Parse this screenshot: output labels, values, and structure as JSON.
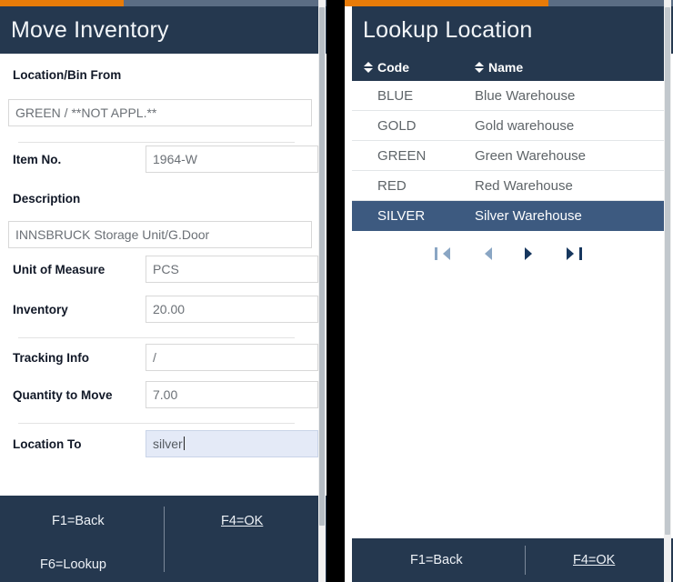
{
  "left_panel": {
    "title": "Move Inventory",
    "progress_color": "#e87b08",
    "fields": [
      {
        "label": "Location/Bin From",
        "value": "GREEN /  **NOT APPL.**"
      },
      {
        "label": "Item No.",
        "value": "1964-W"
      },
      {
        "label": "Description",
        "value": "INNSBRUCK Storage Unit/G.Door"
      },
      {
        "label": "Unit of Measure",
        "value": "PCS"
      },
      {
        "label": "Inventory",
        "value": "20.00"
      },
      {
        "label": "Tracking Info",
        "value": "/"
      },
      {
        "label": "Quantity to Move",
        "value": "7.00"
      },
      {
        "label": "Location To",
        "value": "silver"
      }
    ],
    "footer": {
      "back": "F1=Back",
      "ok": "F4=OK",
      "lookup": "F6=Lookup"
    }
  },
  "right_panel": {
    "title": "Lookup Location",
    "table": {
      "columns": [
        "Code",
        "Name"
      ],
      "rows": [
        {
          "code": "BLUE",
          "name": "Blue Warehouse",
          "selected": false
        },
        {
          "code": "GOLD",
          "name": "Gold warehouse",
          "selected": false
        },
        {
          "code": "GREEN",
          "name": "Green Warehouse",
          "selected": false
        },
        {
          "code": "RED",
          "name": "Red Warehouse",
          "selected": false
        },
        {
          "code": "SILVER",
          "name": "Silver Warehouse",
          "selected": true
        }
      ]
    },
    "pagination": {
      "first": "first-page",
      "previous": "previous-page",
      "next": "next-page",
      "last": "last-page"
    },
    "footer": {
      "back": "F1=Back",
      "ok": "F4=OK"
    }
  },
  "theme": {
    "header_bg": "#25384f",
    "accent": "#e87b08",
    "selection": "#3d5a80",
    "focus_field": "#e4eaf7"
  }
}
